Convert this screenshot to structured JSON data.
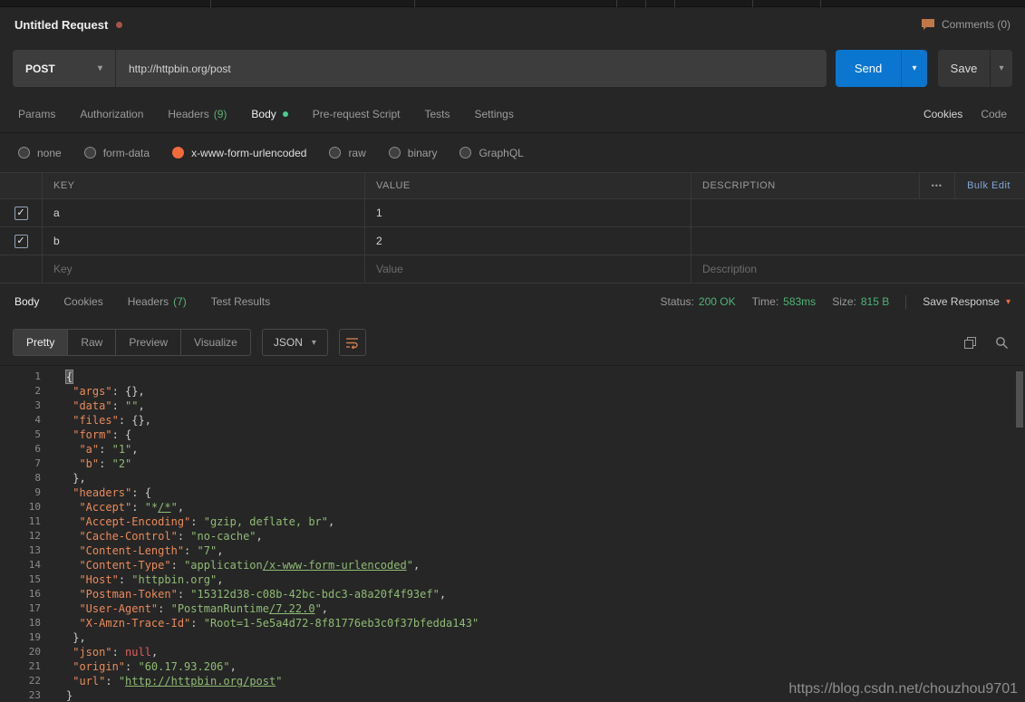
{
  "icons": {
    "caret_down": "▾",
    "check": "✓",
    "more": "•••"
  },
  "header": {
    "title": "Untitled Request",
    "comments_label": "Comments (0)"
  },
  "request_bar": {
    "method": "POST",
    "url": "http://httpbin.org/post",
    "send_label": "Send",
    "save_label": "Save"
  },
  "request_tabs": {
    "tabs": [
      {
        "label": "Params"
      },
      {
        "label": "Authorization"
      },
      {
        "label": "Headers",
        "count": "(9)"
      },
      {
        "label": "Body",
        "active": true,
        "dot": true
      },
      {
        "label": "Pre-request Script"
      },
      {
        "label": "Tests"
      },
      {
        "label": "Settings"
      }
    ],
    "cookies_link": "Cookies",
    "code_link": "Code"
  },
  "body_type_options": [
    {
      "label": "none"
    },
    {
      "label": "form-data"
    },
    {
      "label": "x-www-form-urlencoded",
      "selected": true
    },
    {
      "label": "raw"
    },
    {
      "label": "binary"
    },
    {
      "label": "GraphQL"
    }
  ],
  "params_table": {
    "columns": [
      "KEY",
      "VALUE",
      "DESCRIPTION"
    ],
    "bulk_edit_label": "Bulk Edit",
    "rows": [
      {
        "key": "a",
        "value": "1",
        "description": "",
        "checked": true
      },
      {
        "key": "b",
        "value": "2",
        "description": "",
        "checked": true
      }
    ],
    "placeholders": {
      "key": "Key",
      "value": "Value",
      "description": "Description"
    }
  },
  "response": {
    "tabs": [
      {
        "label": "Body",
        "active": true
      },
      {
        "label": "Cookies"
      },
      {
        "label": "Headers",
        "count": "(7)"
      },
      {
        "label": "Test Results"
      }
    ],
    "meta": {
      "status_label": "Status:",
      "status": "200 OK",
      "time_label": "Time:",
      "time": "583ms",
      "size_label": "Size:",
      "size": "815 B"
    },
    "save_response_label": "Save Response",
    "view_modes": [
      {
        "label": "Pretty",
        "active": true
      },
      {
        "label": "Raw"
      },
      {
        "label": "Preview"
      },
      {
        "label": "Visualize"
      }
    ],
    "language": "JSON"
  },
  "response_body": {
    "lines": [
      {
        "n": 1,
        "ind": 0,
        "toks": [
          [
            "m",
            "{"
          ]
        ]
      },
      {
        "n": 2,
        "ind": 1,
        "toks": [
          [
            "k",
            "\"args\""
          ],
          [
            "d",
            ": "
          ],
          [
            "d",
            "{},"
          ]
        ]
      },
      {
        "n": 3,
        "ind": 1,
        "toks": [
          [
            "k",
            "\"data\""
          ],
          [
            "d",
            ": "
          ],
          [
            "s",
            "\"\""
          ],
          [
            "d",
            ","
          ]
        ]
      },
      {
        "n": 4,
        "ind": 1,
        "toks": [
          [
            "k",
            "\"files\""
          ],
          [
            "d",
            ": "
          ],
          [
            "d",
            "{},"
          ]
        ]
      },
      {
        "n": 5,
        "ind": 1,
        "toks": [
          [
            "k",
            "\"form\""
          ],
          [
            "d",
            ": "
          ],
          [
            "d",
            "{"
          ]
        ]
      },
      {
        "n": 6,
        "ind": 2,
        "toks": [
          [
            "k",
            "\"a\""
          ],
          [
            "d",
            ": "
          ],
          [
            "s",
            "\"1\""
          ],
          [
            "d",
            ","
          ]
        ]
      },
      {
        "n": 7,
        "ind": 2,
        "toks": [
          [
            "k",
            "\"b\""
          ],
          [
            "d",
            ": "
          ],
          [
            "s",
            "\"2\""
          ]
        ]
      },
      {
        "n": 8,
        "ind": 1,
        "toks": [
          [
            "d",
            "},"
          ]
        ]
      },
      {
        "n": 9,
        "ind": 1,
        "toks": [
          [
            "k",
            "\"headers\""
          ],
          [
            "d",
            ": "
          ],
          [
            "d",
            "{"
          ]
        ]
      },
      {
        "n": 10,
        "ind": 2,
        "toks": [
          [
            "k",
            "\"Accept\""
          ],
          [
            "d",
            ": "
          ],
          [
            "s",
            "\"*"
          ],
          [
            "u",
            "/*"
          ],
          [
            "s",
            "\""
          ],
          [
            "d",
            ","
          ]
        ]
      },
      {
        "n": 11,
        "ind": 2,
        "toks": [
          [
            "k",
            "\"Accept-Encoding\""
          ],
          [
            "d",
            ": "
          ],
          [
            "s",
            "\"gzip, deflate, br\""
          ],
          [
            "d",
            ","
          ]
        ]
      },
      {
        "n": 12,
        "ind": 2,
        "toks": [
          [
            "k",
            "\"Cache-Control\""
          ],
          [
            "d",
            ": "
          ],
          [
            "s",
            "\"no-cache\""
          ],
          [
            "d",
            ","
          ]
        ]
      },
      {
        "n": 13,
        "ind": 2,
        "toks": [
          [
            "k",
            "\"Content-Length\""
          ],
          [
            "d",
            ": "
          ],
          [
            "s",
            "\"7\""
          ],
          [
            "d",
            ","
          ]
        ]
      },
      {
        "n": 14,
        "ind": 2,
        "toks": [
          [
            "k",
            "\"Content-Type\""
          ],
          [
            "d",
            ": "
          ],
          [
            "s",
            "\"application"
          ],
          [
            "u",
            "/x-www-form-urlencoded"
          ],
          [
            "s",
            "\""
          ],
          [
            "d",
            ","
          ]
        ]
      },
      {
        "n": 15,
        "ind": 2,
        "toks": [
          [
            "k",
            "\"Host\""
          ],
          [
            "d",
            ": "
          ],
          [
            "s",
            "\"httpbin.org\""
          ],
          [
            "d",
            ","
          ]
        ]
      },
      {
        "n": 16,
        "ind": 2,
        "toks": [
          [
            "k",
            "\"Postman-Token\""
          ],
          [
            "d",
            ": "
          ],
          [
            "s",
            "\"15312d38-c08b-42bc-bdc3-a8a20f4f93ef\""
          ],
          [
            "d",
            ","
          ]
        ]
      },
      {
        "n": 17,
        "ind": 2,
        "toks": [
          [
            "k",
            "\"User-Agent\""
          ],
          [
            "d",
            ": "
          ],
          [
            "s",
            "\"PostmanRuntime"
          ],
          [
            "u",
            "/7.22.0"
          ],
          [
            "s",
            "\""
          ],
          [
            "d",
            ","
          ]
        ]
      },
      {
        "n": 18,
        "ind": 2,
        "toks": [
          [
            "k",
            "\"X-Amzn-Trace-Id\""
          ],
          [
            "d",
            ": "
          ],
          [
            "s",
            "\"Root=1-5e5a4d72-8f81776eb3c0f37bfedda143\""
          ]
        ]
      },
      {
        "n": 19,
        "ind": 1,
        "toks": [
          [
            "d",
            "},"
          ]
        ]
      },
      {
        "n": 20,
        "ind": 1,
        "toks": [
          [
            "k",
            "\"json\""
          ],
          [
            "d",
            ": "
          ],
          [
            "r",
            "null"
          ],
          [
            "d",
            ","
          ]
        ]
      },
      {
        "n": 21,
        "ind": 1,
        "toks": [
          [
            "k",
            "\"origin\""
          ],
          [
            "d",
            ": "
          ],
          [
            "s",
            "\"60.17.93.206\""
          ],
          [
            "d",
            ","
          ]
        ]
      },
      {
        "n": 22,
        "ind": 1,
        "toks": [
          [
            "k",
            "\"url\""
          ],
          [
            "d",
            ": "
          ],
          [
            "s",
            "\""
          ],
          [
            "u",
            "http://httpbin.org/post"
          ],
          [
            "s",
            "\""
          ]
        ]
      },
      {
        "n": 23,
        "ind": 0,
        "toks": [
          [
            "d",
            "}"
          ]
        ]
      }
    ]
  },
  "watermark": "https://blog.csdn.net/chouzhou9701"
}
